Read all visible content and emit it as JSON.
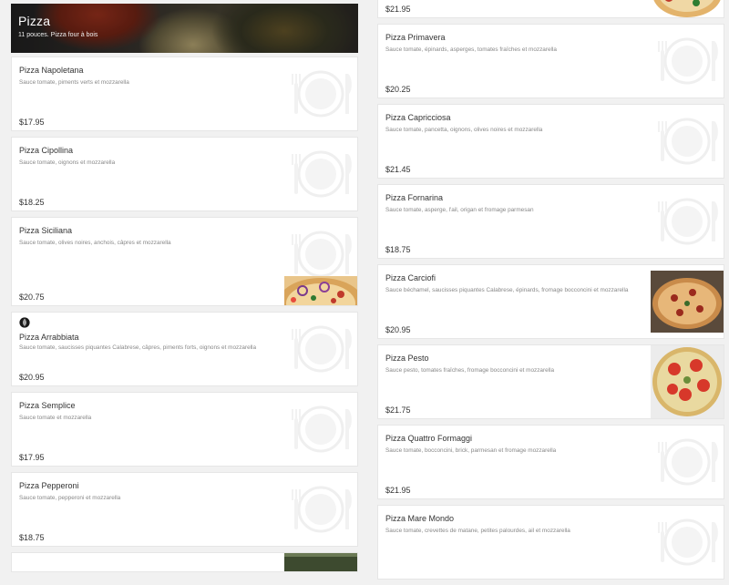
{
  "category": {
    "title": "Pizza",
    "subtitle": "11 pouces. Pizza four à bois"
  },
  "left_items": [
    {
      "name": "Pizza Napoletana",
      "desc": "Sauce tomate, piments verts et mozzarella",
      "price": "$17.95"
    },
    {
      "name": "Pizza Cipollina",
      "desc": "Sauce tomate, oignons et mozzarella",
      "price": "$18.25"
    },
    {
      "name": "Pizza Siciliana",
      "desc": "Sauce tomate, olives noires, anchois, câpres et mozzarella",
      "price": "$20.75"
    },
    {
      "name": "Pizza Arrabbiata",
      "desc": "Sauce tomate, saucisses piquantes Calabrese, câpres, piments forts, oignons et mozzarella",
      "price": "$20.95"
    },
    {
      "name": "Pizza Semplice",
      "desc": "Sauce tomate et mozzarella",
      "price": "$17.95"
    },
    {
      "name": "Pizza Pepperoni",
      "desc": "Sauce tomate, pepperoni et mozzarella",
      "price": "$18.75"
    }
  ],
  "right_items": [
    {
      "name": "",
      "desc": "",
      "price": "$21.95"
    },
    {
      "name": "Pizza Primavera",
      "desc": "Sauce tomate, épinards, asperges, tomates fraîches et mozzarella",
      "price": "$20.25"
    },
    {
      "name": "Pizza Capricciosa",
      "desc": "Sauce tomate, pancetta, oignons, olives noires et mozzarella",
      "price": "$21.45"
    },
    {
      "name": "Pizza Fornarina",
      "desc": "Sauce tomate, asperge, l'ail, origan et fromage parmesan",
      "price": "$18.75"
    },
    {
      "name": "Pizza Carciofi",
      "desc": "Sauce béchamel, saucisses piquantes Calabrese, épinards, fromage bocconcini et mozzarella",
      "price": "$20.95"
    },
    {
      "name": "Pizza Pesto",
      "desc": "Sauce pesto, tomates fraîches, fromage bocconcini et mozzarella",
      "price": "$21.75"
    },
    {
      "name": "Pizza Quattro Formaggi",
      "desc": "Sauce tomate, bocconcini, brick, parmesan et fromage mozzarella",
      "price": "$21.95"
    },
    {
      "name": "Pizza Mare Mondo",
      "desc": "Sauce tomate, crevettes de matane, petites palourdes, ail et mozzarella",
      "price": ""
    }
  ],
  "colors": {
    "card_bg": "#ffffff",
    "page_bg": "#f1f1f1",
    "text": "#333333",
    "muted": "#888888"
  },
  "icons": {
    "placeholder": "plate-fork-knife-icon",
    "vegetarian": "leaf-icon"
  }
}
